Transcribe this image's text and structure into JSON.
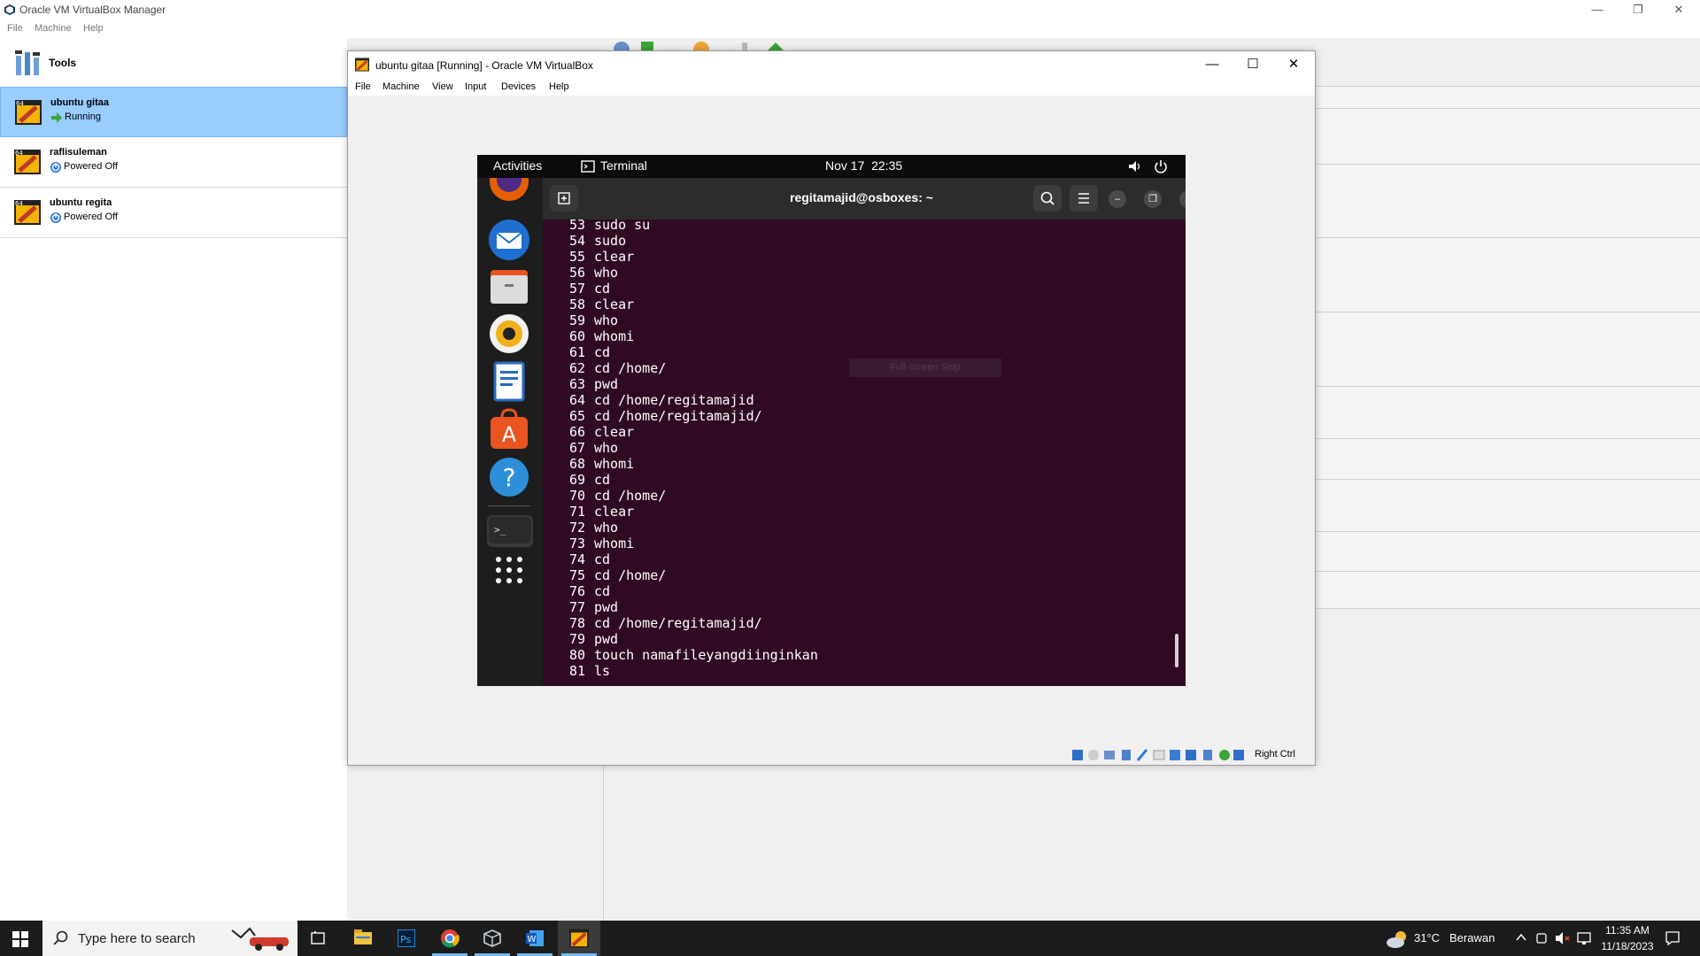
{
  "manager": {
    "title": "Oracle VM VirtualBox Manager",
    "menu": [
      "File",
      "Machine",
      "Help"
    ],
    "tools_label": "Tools",
    "vms": [
      {
        "name": "ubuntu gitaa",
        "state": "Running"
      },
      {
        "name": "raflisuleman",
        "state": "Powered Off"
      },
      {
        "name": "ubuntu regita",
        "state": "Powered Off"
      }
    ]
  },
  "vm_window": {
    "title": "ubuntu gitaa [Running] - Oracle VM VirtualBox",
    "menu": [
      "File",
      "Machine",
      "View",
      "Input",
      "Devices",
      "Help"
    ],
    "host_key": "Right Ctrl"
  },
  "guest": {
    "topbar": {
      "activities": "Activities",
      "app": "Terminal",
      "datetime": "Nov 17  22:35"
    },
    "terminal": {
      "title": "regitamajid@osboxes: ~",
      "history": [
        {
          "n": "53",
          "cmd": "sudo su"
        },
        {
          "n": "54",
          "cmd": "sudo"
        },
        {
          "n": "55",
          "cmd": "clear"
        },
        {
          "n": "56",
          "cmd": "who"
        },
        {
          "n": "57",
          "cmd": "cd"
        },
        {
          "n": "58",
          "cmd": "clear"
        },
        {
          "n": "59",
          "cmd": "who"
        },
        {
          "n": "60",
          "cmd": "whomi"
        },
        {
          "n": "61",
          "cmd": "cd"
        },
        {
          "n": "62",
          "cmd": "cd /home/"
        },
        {
          "n": "63",
          "cmd": "pwd"
        },
        {
          "n": "64",
          "cmd": "cd /home/regitamajid"
        },
        {
          "n": "65",
          "cmd": "cd /home/regitamajid/"
        },
        {
          "n": "66",
          "cmd": "clear"
        },
        {
          "n": "67",
          "cmd": "who"
        },
        {
          "n": "68",
          "cmd": "whomi"
        },
        {
          "n": "69",
          "cmd": "cd"
        },
        {
          "n": "70",
          "cmd": "cd /home/"
        },
        {
          "n": "71",
          "cmd": "clear"
        },
        {
          "n": "72",
          "cmd": "who"
        },
        {
          "n": "73",
          "cmd": "whomi"
        },
        {
          "n": "74",
          "cmd": "cd"
        },
        {
          "n": "75",
          "cmd": "cd /home/"
        },
        {
          "n": "76",
          "cmd": "cd"
        },
        {
          "n": "77",
          "cmd": "pwd"
        },
        {
          "n": "78",
          "cmd": "cd /home/regitamajid/"
        },
        {
          "n": "79",
          "cmd": "pwd"
        },
        {
          "n": "80",
          "cmd": "touch namafileyangdiinginkan"
        },
        {
          "n": "81",
          "cmd": "ls"
        }
      ],
      "snip_tooltip": "Full-screen Snip"
    }
  },
  "taskbar": {
    "search_placeholder": "Type here to search",
    "weather_temp": "31°C",
    "weather_desc": "Berawan",
    "time": "11:35 AM",
    "date": "11/18/2023"
  },
  "colors": {
    "selected_vm_bg": "#99ccff",
    "terminal_bg": "#300a24",
    "taskbar_bg": "#1c1c1c",
    "taskbar_accent": "#76b9ed"
  }
}
